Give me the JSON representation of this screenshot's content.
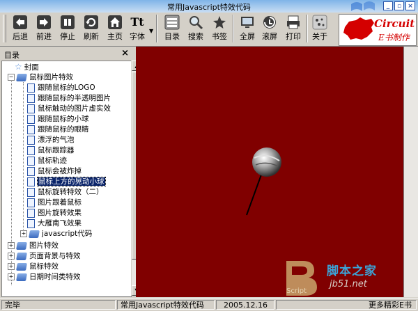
{
  "window": {
    "title": "常用Javascript特效代码"
  },
  "toolbar": {
    "buttons": [
      {
        "label": "后退",
        "icon": "back-arrow-icon"
      },
      {
        "label": "前进",
        "icon": "forward-arrow-icon"
      },
      {
        "label": "停止",
        "icon": "stop-icon"
      },
      {
        "label": "刷新",
        "icon": "refresh-icon"
      },
      {
        "label": "主页",
        "icon": "home-icon"
      },
      {
        "label": "字体",
        "icon": "font-icon"
      },
      {
        "label": "目录",
        "icon": "toc-icon"
      },
      {
        "label": "搜索",
        "icon": "search-icon"
      },
      {
        "label": "书签",
        "icon": "bookmark-icon"
      },
      {
        "label": "全屏",
        "icon": "fullscreen-icon"
      },
      {
        "label": "滚屏",
        "icon": "autoscroll-icon"
      },
      {
        "label": "打印",
        "icon": "print-icon"
      },
      {
        "label": "关于",
        "icon": "about-icon"
      }
    ],
    "font_glyph": "Tt",
    "brand": {
      "line1": "Circuit",
      "line2": "E书制作"
    }
  },
  "sidebar": {
    "title": "目录",
    "close_glyph": "×",
    "tree": [
      {
        "label": "封面",
        "type": "star"
      },
      {
        "label": "鼠标图片特效",
        "type": "open-book"
      },
      {
        "label": "跟随鼠标的LOGO",
        "type": "doc"
      },
      {
        "label": "跟随鼠标的半透明图片",
        "type": "doc"
      },
      {
        "label": "鼠标触动的图片虚实效",
        "type": "doc"
      },
      {
        "label": "跟随鼠标的小球",
        "type": "doc"
      },
      {
        "label": "跟随鼠标的眼睛",
        "type": "doc"
      },
      {
        "label": "漂浮的气泡",
        "type": "doc"
      },
      {
        "label": "鼠标跟踪器",
        "type": "doc"
      },
      {
        "label": "鼠标轨迹",
        "type": "doc"
      },
      {
        "label": "鼠标会被炸掉",
        "type": "doc"
      },
      {
        "label": "鼠标上方的晃动小球",
        "type": "doc",
        "selected": true
      },
      {
        "label": "鼠标旋转特效（二）",
        "type": "doc"
      },
      {
        "label": "图片跟着鼠标",
        "type": "doc"
      },
      {
        "label": "图片旋转效果",
        "type": "doc"
      },
      {
        "label": "大雁南飞效果",
        "type": "doc"
      },
      {
        "label": "javascript代码",
        "type": "book"
      },
      {
        "label": "图片特效",
        "type": "book"
      },
      {
        "label": "页面背景与特效",
        "type": "book"
      },
      {
        "label": "鼠标特效",
        "type": "book"
      },
      {
        "label": "日期时间类特效",
        "type": "book"
      }
    ]
  },
  "content": {
    "background": "#800000",
    "watermark": {
      "big": "脚本之家",
      "url": "jb51.net",
      "script": "Script"
    }
  },
  "statusbar": {
    "status": "完毕",
    "title": "常用Javascript特效代码",
    "date": "2005.12.16",
    "more": "更多精彩E书"
  }
}
